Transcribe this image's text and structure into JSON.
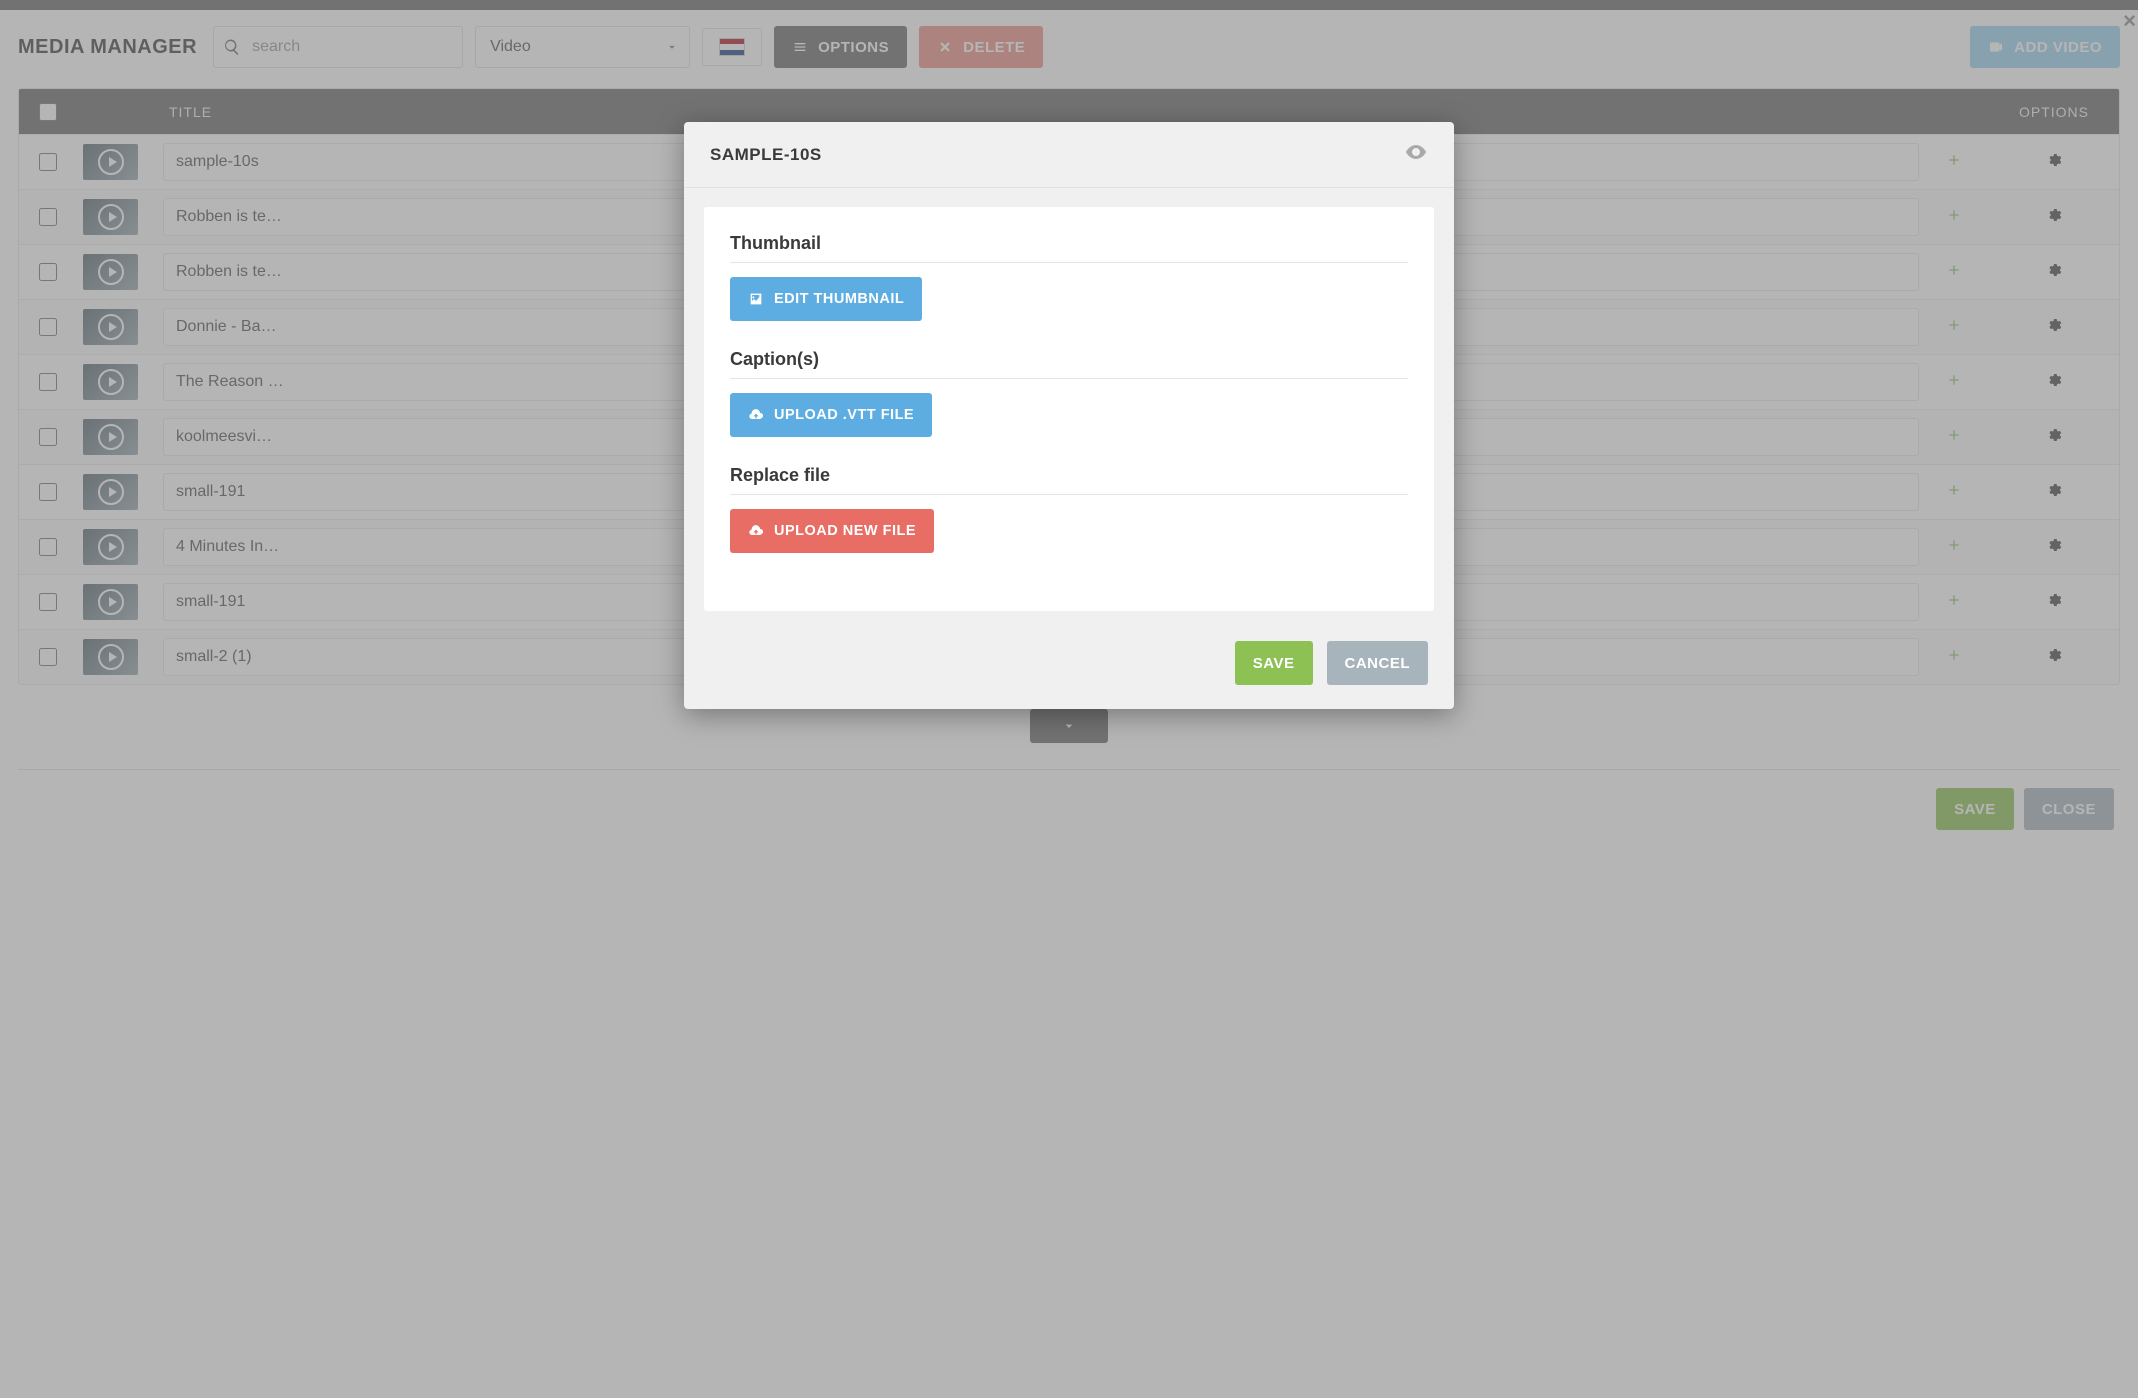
{
  "page_title": "MEDIA MANAGER",
  "search": {
    "placeholder": "search"
  },
  "filter": {
    "selected": "Video"
  },
  "toolbar": {
    "options": "OPTIONS",
    "delete": "DELETE",
    "add": "ADD VIDEO"
  },
  "table": {
    "head": {
      "title": "TITLE",
      "options": "OPTIONS"
    },
    "rows": [
      {
        "title": "sample-10s"
      },
      {
        "title": "Robben is te…"
      },
      {
        "title": "Robben is te…"
      },
      {
        "title": "Donnie - Ba…"
      },
      {
        "title": "The Reason …"
      },
      {
        "title": "koolmeesvi…"
      },
      {
        "title": "small-191"
      },
      {
        "title": "4 Minutes In…"
      },
      {
        "title": "small-191"
      },
      {
        "title": "small-2 (1)"
      }
    ]
  },
  "bottom": {
    "save": "SAVE",
    "close": "CLOSE"
  },
  "modal": {
    "title": "SAMPLE-10S",
    "sections": {
      "thumbnail": {
        "heading": "Thumbnail",
        "btn": "EDIT THUMBNAIL"
      },
      "captions": {
        "heading": "Caption(s)",
        "btn": "UPLOAD .VTT FILE"
      },
      "replace": {
        "heading": "Replace file",
        "btn": "UPLOAD NEW FILE"
      }
    },
    "save": "SAVE",
    "cancel": "CANCEL"
  }
}
